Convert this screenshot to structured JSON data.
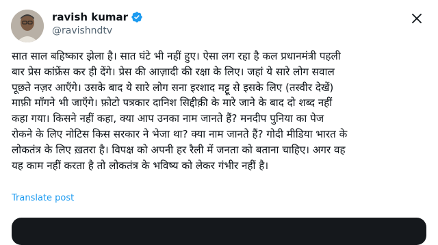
{
  "user": {
    "name": "ravish kumar",
    "handle": "@ravishndtv"
  },
  "tweet": {
    "text": "सात साल बहिष्कार झेला है। सात घंटे भी नहीं हुए। ऐसा लग रहा है कल प्रधानमंत्री पहली\nबार प्रेस कांफ्रेंस कर ही देंगे। प्रेस की आज़ादी की रक्षा के लिए। जहां ये सारे लोग सवाल\nपूछते नज़र आएँगे। उसके बाद ये सारे लोग सना इरशाद मट्टू से इसके लिए (तस्वीर देखें)\nमाफ़ी माँगने भी जाएँगे। फ़ोटो पत्रकार दानिश सिद्दीक़ी के मारे जाने के बाद दो शब्द नहीं\nकहा गया। किसने नहीं कहा, क्या आप उनका नाम जानते हैं? मनदीप पुनिया का  पेज\nरोकने के लिए नोटिस किस सरकार ने भेजा था? क्या नाम जानते हैं? गोदी मीडिया भारत के\nलोकतंत्र के लिए ख़तरा है। विपक्ष को अपनी हर रैली में जनता को बताना चाहिए। अगर वह\nयह काम नहीं करता है तो लोकतंत्र के भविष्य को लेकर गंभीर नहीं है।"
  },
  "translate_label": "Translate post",
  "colors": {
    "verified": "#1d9bf0",
    "link": "#1d9bf0",
    "text": "#0f1419",
    "secondary": "#536471",
    "media_bg": "#15181c"
  },
  "icons": {
    "verified": "verified-badge-icon",
    "close": "close-icon"
  }
}
